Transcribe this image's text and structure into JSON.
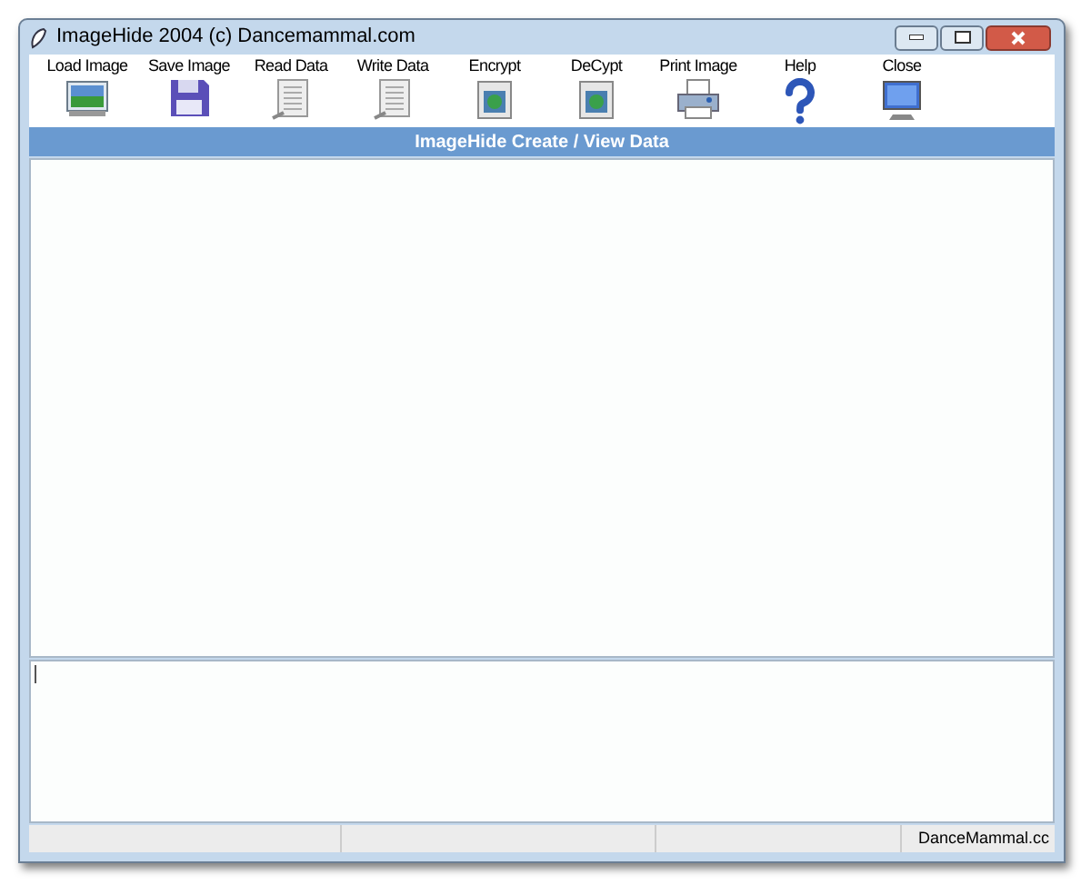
{
  "window": {
    "title": "ImageHide 2004 (c) Dancemammal.com"
  },
  "toolbar": [
    {
      "label": "Load Image",
      "kind": "picture"
    },
    {
      "label": "Save Image",
      "kind": "floppy"
    },
    {
      "label": "Read Data",
      "kind": "document"
    },
    {
      "label": "Write Data",
      "kind": "document"
    },
    {
      "label": "Encrypt",
      "kind": "secure"
    },
    {
      "label": "DeCypt",
      "kind": "secure"
    },
    {
      "label": "Print Image",
      "kind": "printer"
    },
    {
      "label": "Help",
      "kind": "help"
    },
    {
      "label": "Close",
      "kind": "monitor"
    }
  ],
  "header": "ImageHide Create / View Data",
  "status_bar": {
    "site": "DanceMammal.cc"
  }
}
